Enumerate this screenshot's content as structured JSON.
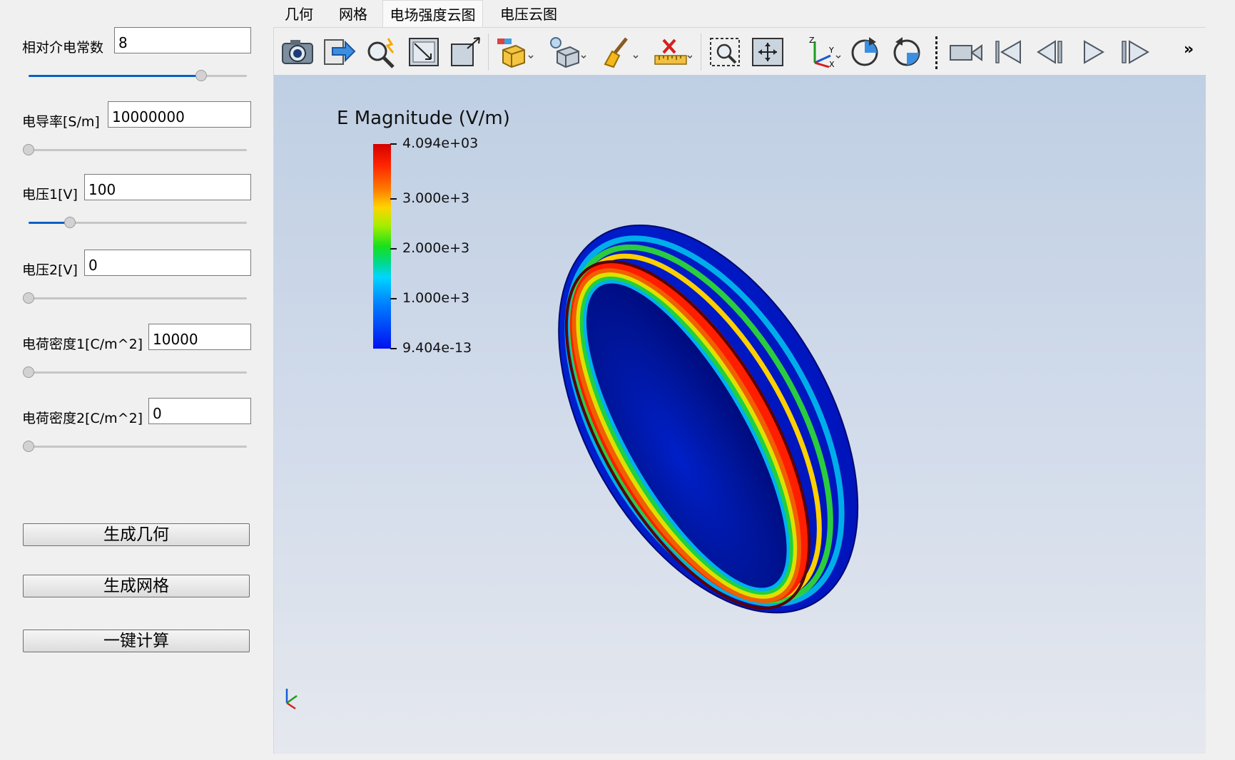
{
  "params": [
    {
      "label": "相对介电常数",
      "value": "8",
      "slider_fraction": 0.79
    },
    {
      "label": "电导率[S/m]",
      "value": "10000000",
      "slider_fraction": 0.0
    },
    {
      "label": "电压1[V]",
      "value": "100",
      "slider_fraction": 0.19
    },
    {
      "label": "电压2[V]",
      "value": "0",
      "slider_fraction": 0.0
    },
    {
      "label": "电荷密度1[C/m^2]",
      "value": "10000",
      "slider_fraction": 0.0
    },
    {
      "label": "电荷密度2[C/m^2]",
      "value": "0",
      "slider_fraction": 0.0
    }
  ],
  "buttons": {
    "generate_geometry": "生成几何",
    "generate_mesh": "生成网格",
    "compute": "一键计算"
  },
  "tabs": [
    {
      "label": "几何",
      "active": false
    },
    {
      "label": "网格",
      "active": false
    },
    {
      "label": "电场强度云图",
      "active": true
    },
    {
      "label": "电压云图",
      "active": false
    }
  ],
  "toolbar": {
    "icons": [
      "camera-icon",
      "export-icon",
      "pick-icon",
      "fit-view-icon",
      "reset-view-icon",
      "box-select-icon",
      "point-select-icon",
      "clear-icon",
      "ruler-icon",
      "zoom-box-icon",
      "pan-icon",
      "axes-icon",
      "rotate-cw-icon",
      "rotate-ccw-icon",
      "video-icon",
      "first-frame-icon",
      "previous-frame-icon",
      "play-icon",
      "next-frame-icon"
    ],
    "more": "»"
  },
  "viewport": {
    "legend_title": "E Magnitude (V/m)",
    "legend_ticks": [
      {
        "label": "4.094e+03",
        "fraction": 0.0
      },
      {
        "label": "3.000e+3",
        "fraction": 0.267
      },
      {
        "label": "2.000e+3",
        "fraction": 0.511
      },
      {
        "label": "1.000e+3",
        "fraction": 0.756
      },
      {
        "label": "9.404e-13",
        "fraction": 1.0
      }
    ],
    "colors": {
      "max": "#ff1a00",
      "min": "#0000d0",
      "dark_rim": "#5a0000"
    }
  }
}
